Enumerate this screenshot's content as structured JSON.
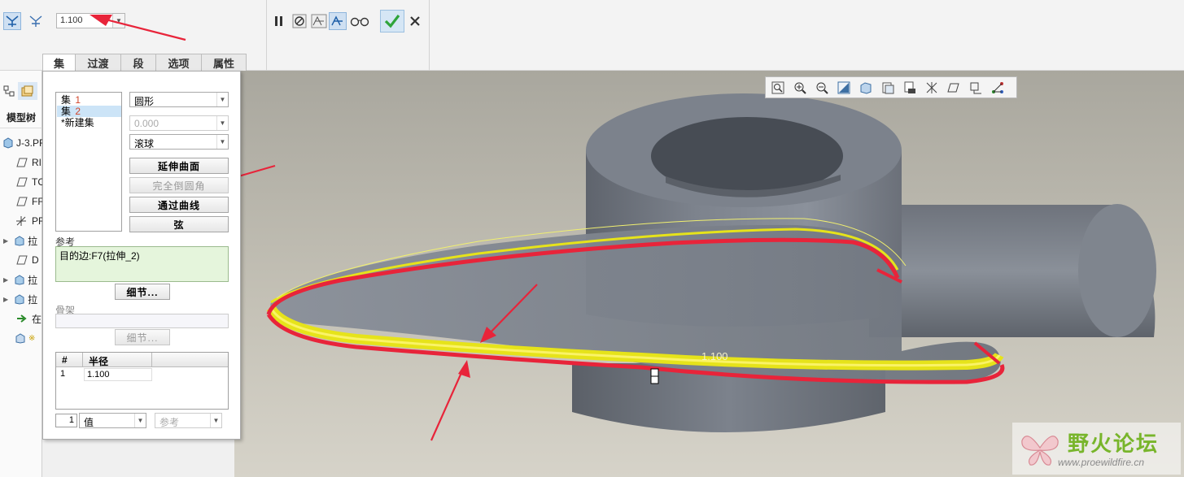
{
  "dashboard": {
    "radius_value": "1.100",
    "tools": [
      {
        "name": "set-mode-icon"
      },
      {
        "name": "transition-mode-icon"
      },
      {
        "name": "pause-icon"
      },
      {
        "name": "no-preview-icon"
      },
      {
        "name": "static-preview-icon"
      },
      {
        "name": "dynamic-preview-icon"
      },
      {
        "name": "verify-icon"
      },
      {
        "name": "confirm-icon"
      },
      {
        "name": "cancel-icon"
      }
    ]
  },
  "tabs": [
    "集",
    "过渡",
    "段",
    "选项",
    "属性"
  ],
  "model_tree": {
    "title": "模型树",
    "items": [
      "J-3.PF",
      "RI",
      "TC",
      "FF",
      "PF",
      "拉",
      "D",
      "拉",
      "拉",
      "在",
      "※"
    ]
  },
  "panel": {
    "sets": [
      {
        "label": "集",
        "num": "1"
      },
      {
        "label": "集",
        "num": "2"
      },
      {
        "label": "*新建集",
        "num": ""
      }
    ],
    "shape_combo": "圆形",
    "value_combo": "0.000",
    "method_combo": "滚球",
    "btn_extend": "延伸曲面",
    "btn_full_round": "完全倒圆角",
    "btn_through_curve": "通过曲线",
    "btn_chord": "弦",
    "refs_label": "参考",
    "refs_value": "目的边:F7(拉伸_2)",
    "details_btn": "细节...",
    "spine_label": "骨架",
    "details_btn2": "细节...",
    "table_headers": [
      "#",
      "半径"
    ],
    "table_rows": [
      {
        "idx": "1",
        "radius": "1.100"
      }
    ],
    "bottom_index": "1",
    "bottom_value_combo": "值",
    "bottom_ref_combo": "参考"
  },
  "viewport": {
    "dimension_label": "1.100",
    "toolbar": [
      "refit-icon",
      "zoom-in-icon",
      "zoom-out-icon",
      "repaint-icon",
      "display-style-icon",
      "saved-views-icon",
      "view-manager-icon",
      "datum-display-icon",
      "annotation-display-icon",
      "spin-center-icon",
      "csys-display-icon"
    ]
  },
  "watermark": {
    "title": "野火论坛",
    "url": "www.proewildfire.cn"
  },
  "colors": {
    "annotation_red": "#e8243a",
    "fillet_yellow": "#e6e31a",
    "part_gray": "#7c828d",
    "confirm_green": "#2fa43a"
  }
}
